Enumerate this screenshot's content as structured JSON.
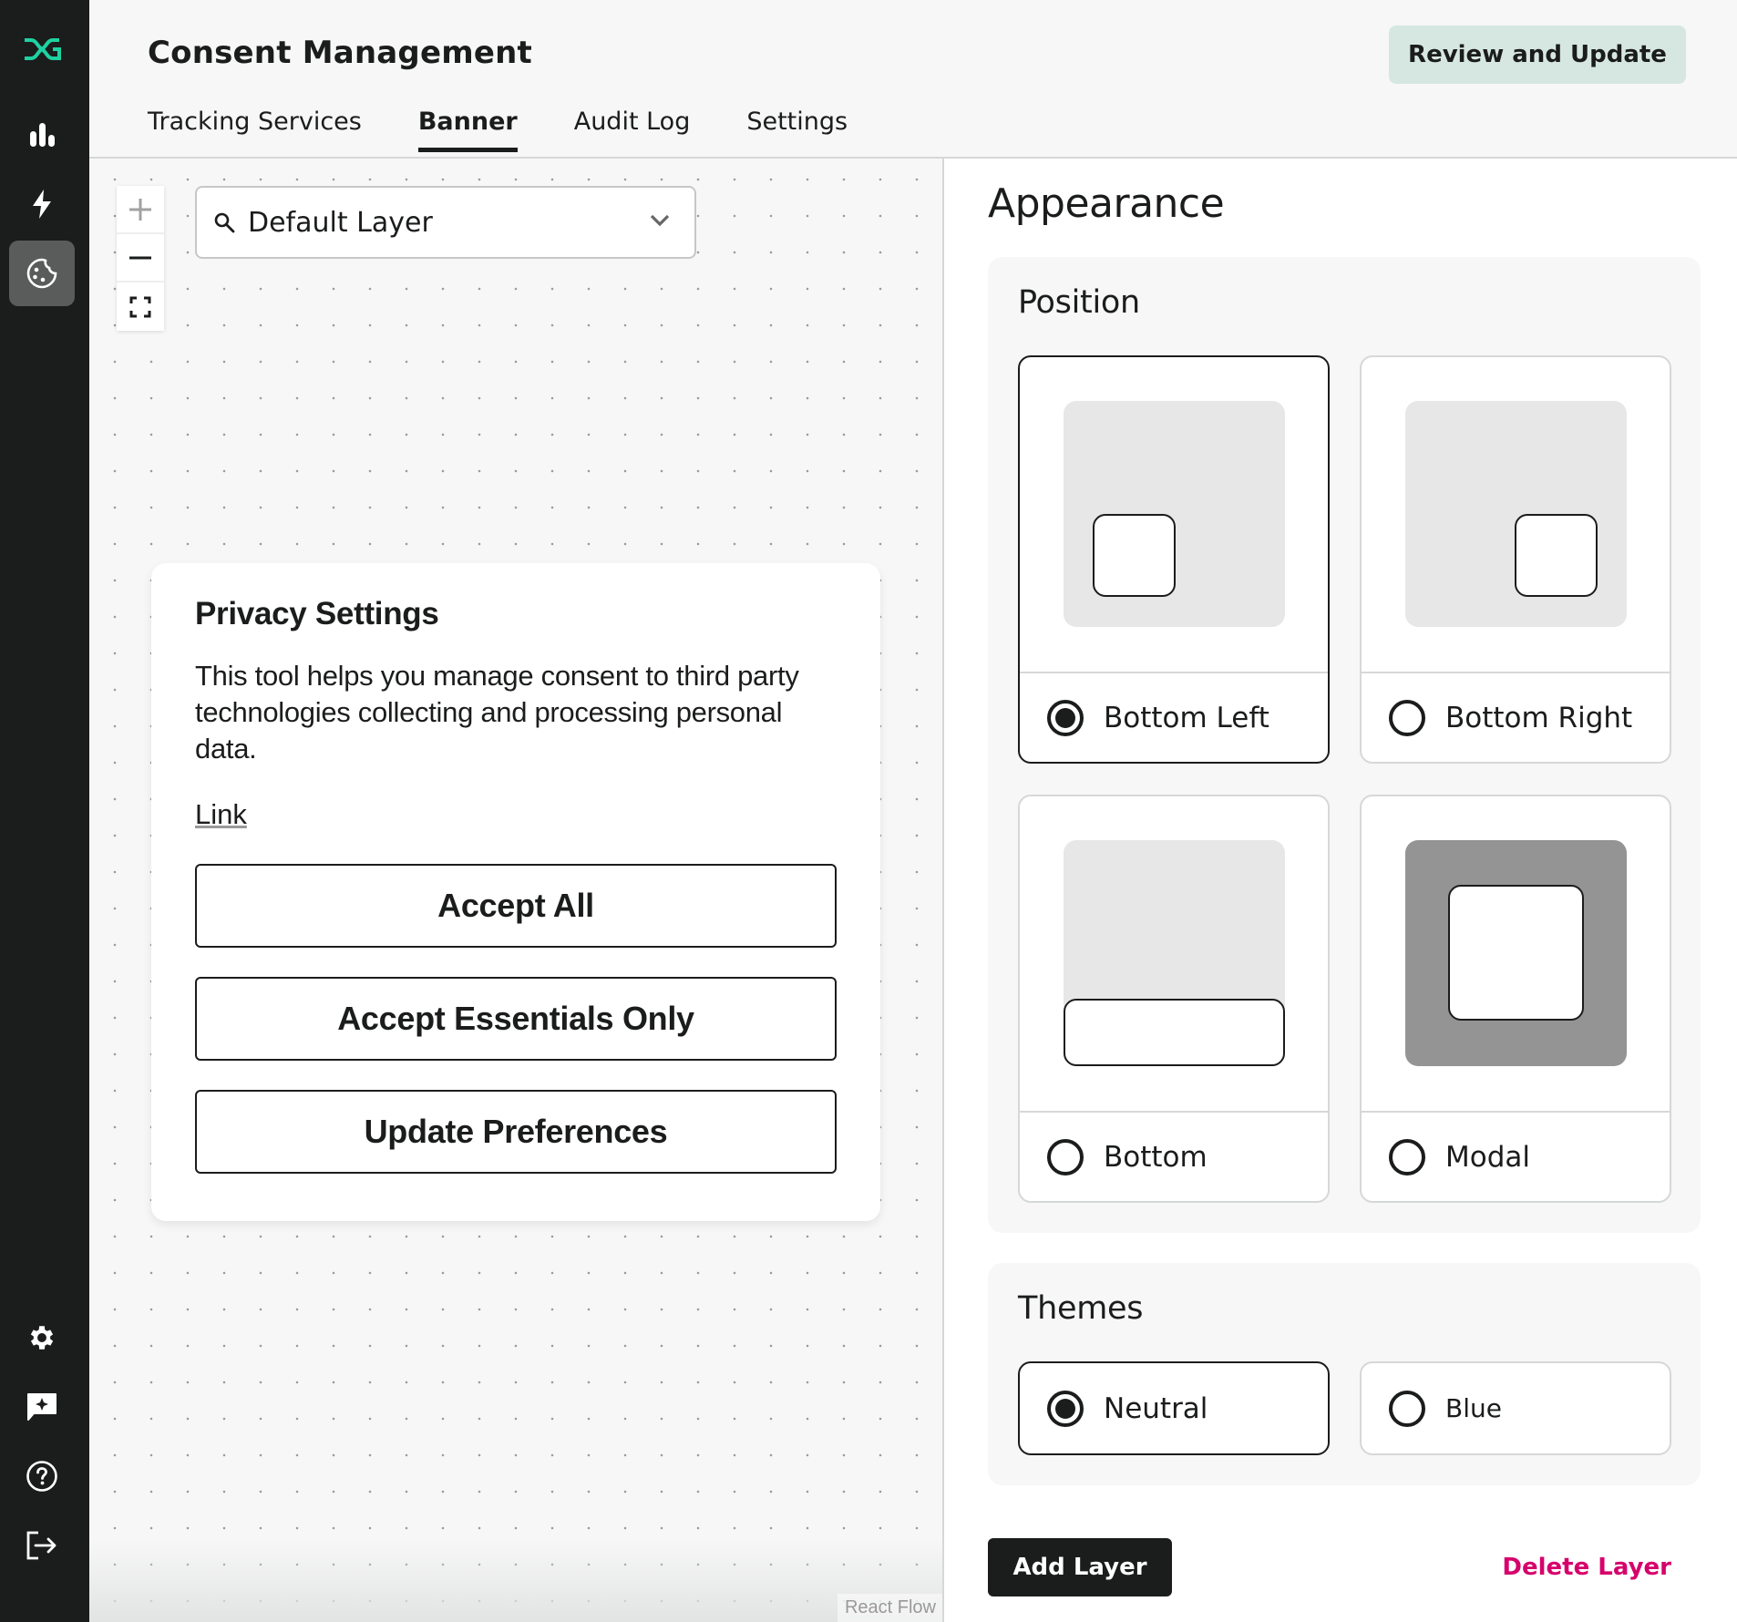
{
  "app": {
    "logo": "dg-logo-icon",
    "brand_color": "#1fd1a0"
  },
  "sidebar": {
    "items": [
      {
        "name": "analytics",
        "icon": "bar-chart-icon",
        "active": false
      },
      {
        "name": "automation",
        "icon": "lightning-icon",
        "active": false
      },
      {
        "name": "consent-management",
        "icon": "cookie-icon",
        "active": true
      }
    ],
    "bottom_items": [
      {
        "name": "settings",
        "icon": "gear-icon"
      },
      {
        "name": "feedback",
        "icon": "sparkle-chat-icon"
      },
      {
        "name": "help",
        "icon": "help-circle-icon"
      },
      {
        "name": "logout",
        "icon": "logout-icon"
      }
    ]
  },
  "header": {
    "title": "Consent Management",
    "primary_button": "Review and Update",
    "tabs": [
      {
        "label": "Tracking Services",
        "active": false
      },
      {
        "label": "Banner",
        "active": true
      },
      {
        "label": "Audit Log",
        "active": false
      },
      {
        "label": "Settings",
        "active": false
      }
    ]
  },
  "canvas": {
    "zoom_controls": [
      {
        "name": "zoom-in",
        "icon": "plus-icon"
      },
      {
        "name": "zoom-out",
        "icon": "minus-icon"
      },
      {
        "name": "fit-view",
        "icon": "fit-view-icon"
      }
    ],
    "layer_select": {
      "icon": "search-icon",
      "value": "Default Layer"
    },
    "banner_preview": {
      "title": "Privacy Settings",
      "body": "This tool helps you manage consent to third party technologies collecting and processing personal data.",
      "link": "Link",
      "buttons": [
        "Accept All",
        "Accept Essentials Only",
        "Update Preferences"
      ]
    },
    "attribution": "React Flow"
  },
  "appearance": {
    "title": "Appearance",
    "position": {
      "title": "Position",
      "options": [
        {
          "label": "Bottom Left",
          "selected": true
        },
        {
          "label": "Bottom Right",
          "selected": false
        },
        {
          "label": "Bottom",
          "selected": false
        },
        {
          "label": "Modal",
          "selected": false
        }
      ]
    },
    "themes": {
      "title": "Themes",
      "options": [
        {
          "label": "Neutral",
          "selected": true
        },
        {
          "label": "Blue",
          "selected": false
        }
      ]
    },
    "add_layer": "Add Layer",
    "delete_layer": "Delete Layer",
    "delete_color": "#d6006b"
  }
}
